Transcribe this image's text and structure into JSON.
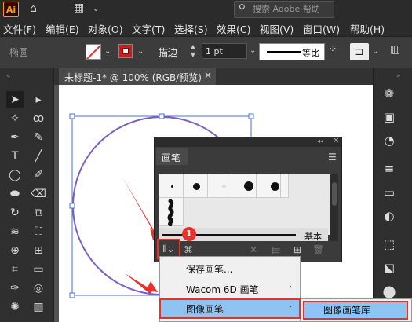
{
  "titlebar": {
    "app_badge": "Ai",
    "search_text": "搜索 Adobe 帮助",
    "search_icon": "search-icon"
  },
  "menubar": {
    "items": [
      "文件(F)",
      "编辑(E)",
      "对象(O)",
      "文字(T)",
      "选择(S)",
      "效果(C)",
      "视图(V)",
      "窗口(W)",
      "帮助(H)"
    ]
  },
  "controlbar": {
    "shape_name": "椭圆",
    "stroke_label": "描边",
    "stroke_value": "1 pt",
    "profile_label": "等比",
    "fill_color": "#ffffff",
    "stroke_color": "#c02020"
  },
  "document": {
    "tab_label": "未标题-1* @ 100% (RGB/预览)",
    "circle_color": "#7b5fc2",
    "selection_color": "#4a6fd8"
  },
  "brush_panel": {
    "tab_label": "画笔",
    "basic_label": "基本",
    "badge_number": "1"
  },
  "context_menu": {
    "items": [
      "保存画笔...",
      "Wacom 6D 画笔",
      "图像画笔"
    ],
    "submenu_item": "图像画笔库"
  }
}
